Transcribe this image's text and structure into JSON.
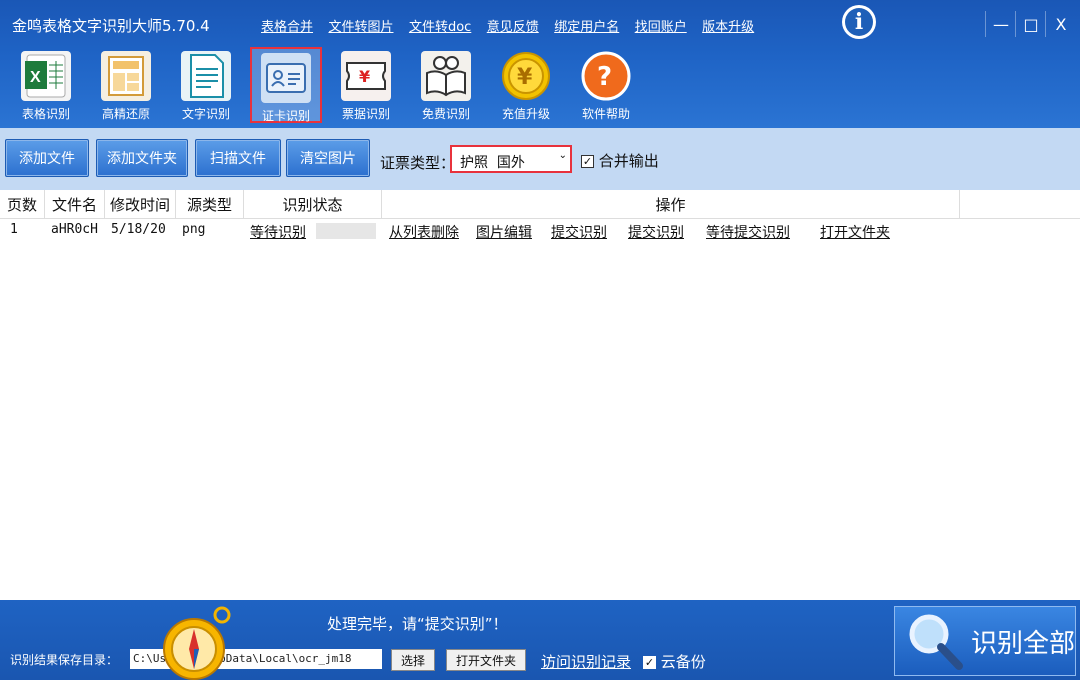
{
  "title_bar": {
    "app_title": "金鸣表格文字识别大师5.70.4",
    "links": [
      "表格合并",
      "文件转图片",
      "文件转doc",
      "意见反馈",
      "绑定用户名",
      "找回账户",
      "版本升级"
    ],
    "info_icon": "info-icon",
    "window_controls": {
      "minimize": "—",
      "maximize": "□",
      "close": "X"
    }
  },
  "toolbar": [
    {
      "label": "表格识别",
      "icon": "excel-icon",
      "active": false
    },
    {
      "label": "高精还原",
      "icon": "layout-icon",
      "active": false
    },
    {
      "label": "文字识别",
      "icon": "document-icon",
      "active": false
    },
    {
      "label": "证卡识别",
      "icon": "id-card-icon",
      "active": true
    },
    {
      "label": "票据识别",
      "icon": "receipt-icon",
      "active": false
    },
    {
      "label": "免费识别",
      "icon": "book-icon",
      "active": false
    },
    {
      "label": "充值升级",
      "icon": "coin-icon",
      "active": false
    },
    {
      "label": "软件帮助",
      "icon": "help-icon",
      "active": false
    }
  ],
  "actions": {
    "add_file": "添加文件",
    "add_folder": "添加文件夹",
    "scan_file": "扫描文件",
    "clear_images": "清空图片",
    "doc_type_label": "证票类型：",
    "doc_type_value": "护照  国外",
    "merge_output_label": "合并输出",
    "merge_output_checked": true
  },
  "table": {
    "columns": [
      "页数",
      "文件名",
      "修改时间",
      "源类型",
      "识别状态",
      "操作"
    ],
    "rows": [
      {
        "page": "1",
        "filename": "aHR0cH",
        "modified": "5/18/20",
        "source_type": "png",
        "status": "等待识别",
        "ops": [
          "从列表删除",
          "图片编辑",
          "提交识别",
          "提交识别",
          "等待提交识别",
          "打开文件夹"
        ]
      }
    ]
  },
  "bottom": {
    "status_message": "处理完毕，请“提交识别”！",
    "save_dir_label": "识别结果保存目录：",
    "save_dir_value": "C:\\Users\\      \\AppData\\Local\\ocr_jm18",
    "select_button": "选择",
    "open_folder_button": "打开文件夹",
    "history_link": "访问识别记录",
    "cloud_backup_label": "云备份",
    "cloud_backup_checked": true,
    "recognize_all": "识别全部"
  }
}
